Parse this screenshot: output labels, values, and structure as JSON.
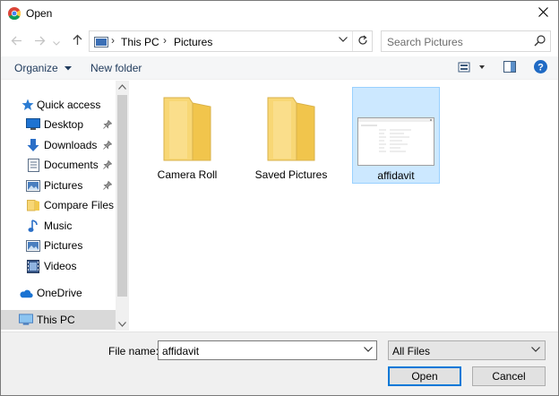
{
  "window": {
    "title": "Open",
    "close_icon": "close-icon",
    "app_icon": "chrome-icon"
  },
  "address_bar": {
    "back_icon": "arrow-left-icon",
    "forward_icon": "arrow-right-icon",
    "recent_icon": "chevron-down-icon",
    "up_icon": "arrow-up-icon",
    "breadcrumbs": [
      "This PC",
      "Pictures"
    ],
    "refresh_icon": "refresh-icon"
  },
  "search": {
    "placeholder": "Search Pictures"
  },
  "toolbar": {
    "organize_label": "Organize",
    "new_folder_label": "New folder",
    "view_icon": "view-options-icon",
    "preview_icon": "preview-pane-icon",
    "help_icon": "help-icon"
  },
  "nav_pane": {
    "quick_access": "Quick access",
    "items": [
      {
        "label": "Desktop",
        "icon": "desktop-icon",
        "pinned": true
      },
      {
        "label": "Downloads",
        "icon": "downloads-icon",
        "pinned": true
      },
      {
        "label": "Documents",
        "icon": "documents-icon",
        "pinned": true
      },
      {
        "label": "Pictures",
        "icon": "pictures-icon",
        "pinned": true
      },
      {
        "label": "Compare Files",
        "icon": "folder-icon",
        "pinned": false
      },
      {
        "label": "Music",
        "icon": "music-icon",
        "pinned": false
      },
      {
        "label": "Pictures",
        "icon": "pictures-icon",
        "pinned": false
      },
      {
        "label": "Videos",
        "icon": "videos-icon",
        "pinned": false
      }
    ],
    "onedrive": "OneDrive",
    "this_pc": "This PC"
  },
  "files": [
    {
      "name": "Camera Roll",
      "type": "folder",
      "selected": false
    },
    {
      "name": "Saved Pictures",
      "type": "folder",
      "selected": false
    },
    {
      "name": "affidavit",
      "type": "image",
      "selected": true
    }
  ],
  "bottom": {
    "file_name_label": "File name:",
    "file_name_value": "affidavit",
    "filter_value": "All Files",
    "open_label": "Open",
    "cancel_label": "Cancel"
  },
  "colors": {
    "selection_bg": "#cce8ff",
    "selection_border": "#99d1ff",
    "folder_yellow": "#f8d775",
    "accent_blue": "#0078d7",
    "toolbar_text": "#1e395b"
  }
}
